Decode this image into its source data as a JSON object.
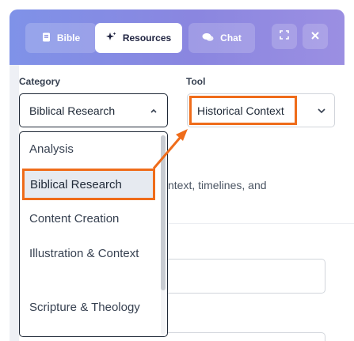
{
  "header": {
    "tabs": [
      {
        "label": "Bible",
        "icon": "book-icon"
      },
      {
        "label": "Resources",
        "icon": "sparkles-icon",
        "active": true
      },
      {
        "label": "Chat",
        "icon": "chat-icon"
      }
    ],
    "expand_icon": "expand-icon",
    "close_icon": "close-icon",
    "gradient": [
      "#7f92e8",
      "#9b8fe2"
    ]
  },
  "form": {
    "category_label": "Category",
    "tool_label": "Tool",
    "category_value": "Biblical Research",
    "tool_value": "Historical Context",
    "description_fragment": "ntext, timelines, and"
  },
  "dropdown": {
    "options": [
      "Analysis",
      "Biblical Research",
      "Content Creation",
      "Illustration & Context",
      "Scripture & Theology"
    ],
    "selected_index": 1
  },
  "highlight_color": "#ef6c1a"
}
